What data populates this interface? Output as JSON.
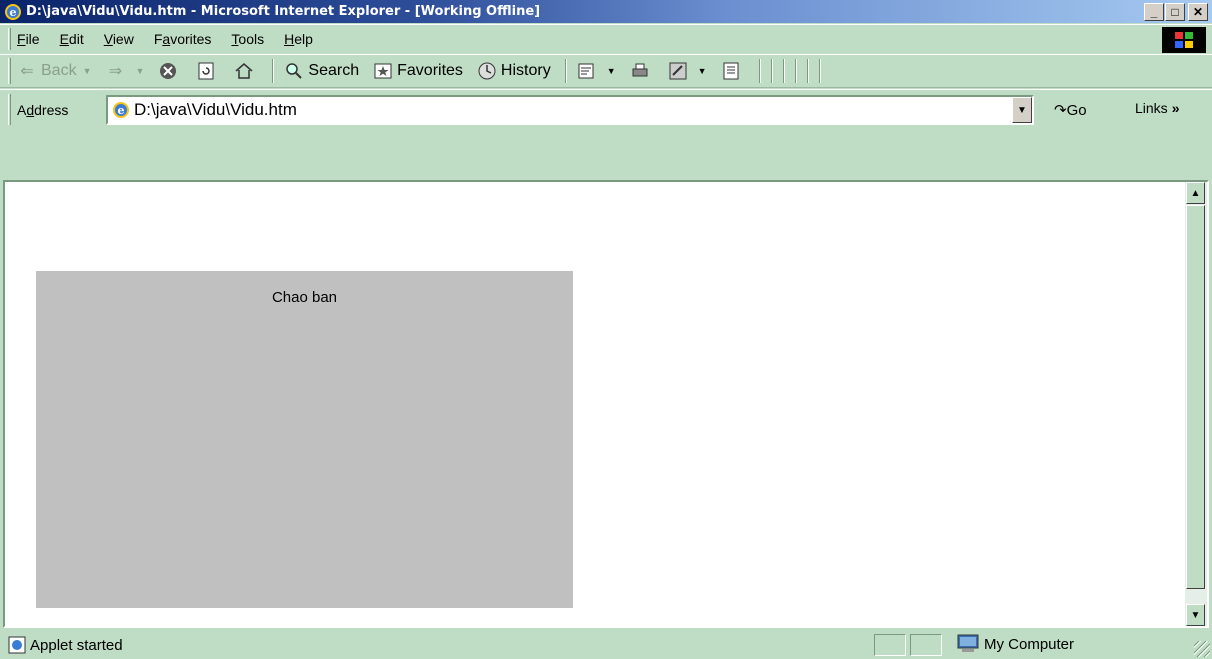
{
  "window": {
    "title": "D:\\java\\Vidu\\Vidu.htm - Microsoft Internet Explorer - [Working Offline]",
    "minimize": "_",
    "maximize": "□",
    "close": "✕"
  },
  "menu": {
    "items": [
      {
        "accel": "F",
        "rest": "ile"
      },
      {
        "accel": "E",
        "rest": "dit"
      },
      {
        "accel": "V",
        "rest": "iew"
      },
      {
        "pre": "F",
        "accel": "a",
        "rest": "vorites"
      },
      {
        "accel": "T",
        "rest": "ools"
      },
      {
        "accel": "H",
        "rest": "elp"
      }
    ]
  },
  "toolbar": {
    "back_label": "Back",
    "search_label": "Search",
    "favorites_label": "Favorites",
    "history_label": "History"
  },
  "address": {
    "label_pre": "A",
    "label_accel": "d",
    "label_rest": "dress",
    "value": "D:\\java\\Vidu\\Vidu.htm",
    "go_label": "Go",
    "links_label": "Links",
    "links_more": "»"
  },
  "content": {
    "applet_text": "Chao ban"
  },
  "status": {
    "text": "Applet started",
    "zone": "My Computer"
  },
  "icons": {
    "ie": "ie-logo-icon",
    "back": "back-arrow-icon",
    "forward": "forward-arrow-icon",
    "stop": "stop-icon",
    "refresh": "refresh-icon",
    "home": "home-icon",
    "search": "search-icon",
    "favorites": "favorites-icon",
    "history": "history-icon",
    "mail": "mail-icon",
    "print": "print-icon",
    "edit": "edit-icon",
    "discuss": "discuss-icon",
    "go": "go-arrow-icon",
    "computer": "computer-icon"
  },
  "colors": {
    "chrome": "#bfdcc4",
    "applet_bg": "#c0c0c0",
    "title_start": "#0a246a",
    "title_end": "#a6caf0"
  }
}
